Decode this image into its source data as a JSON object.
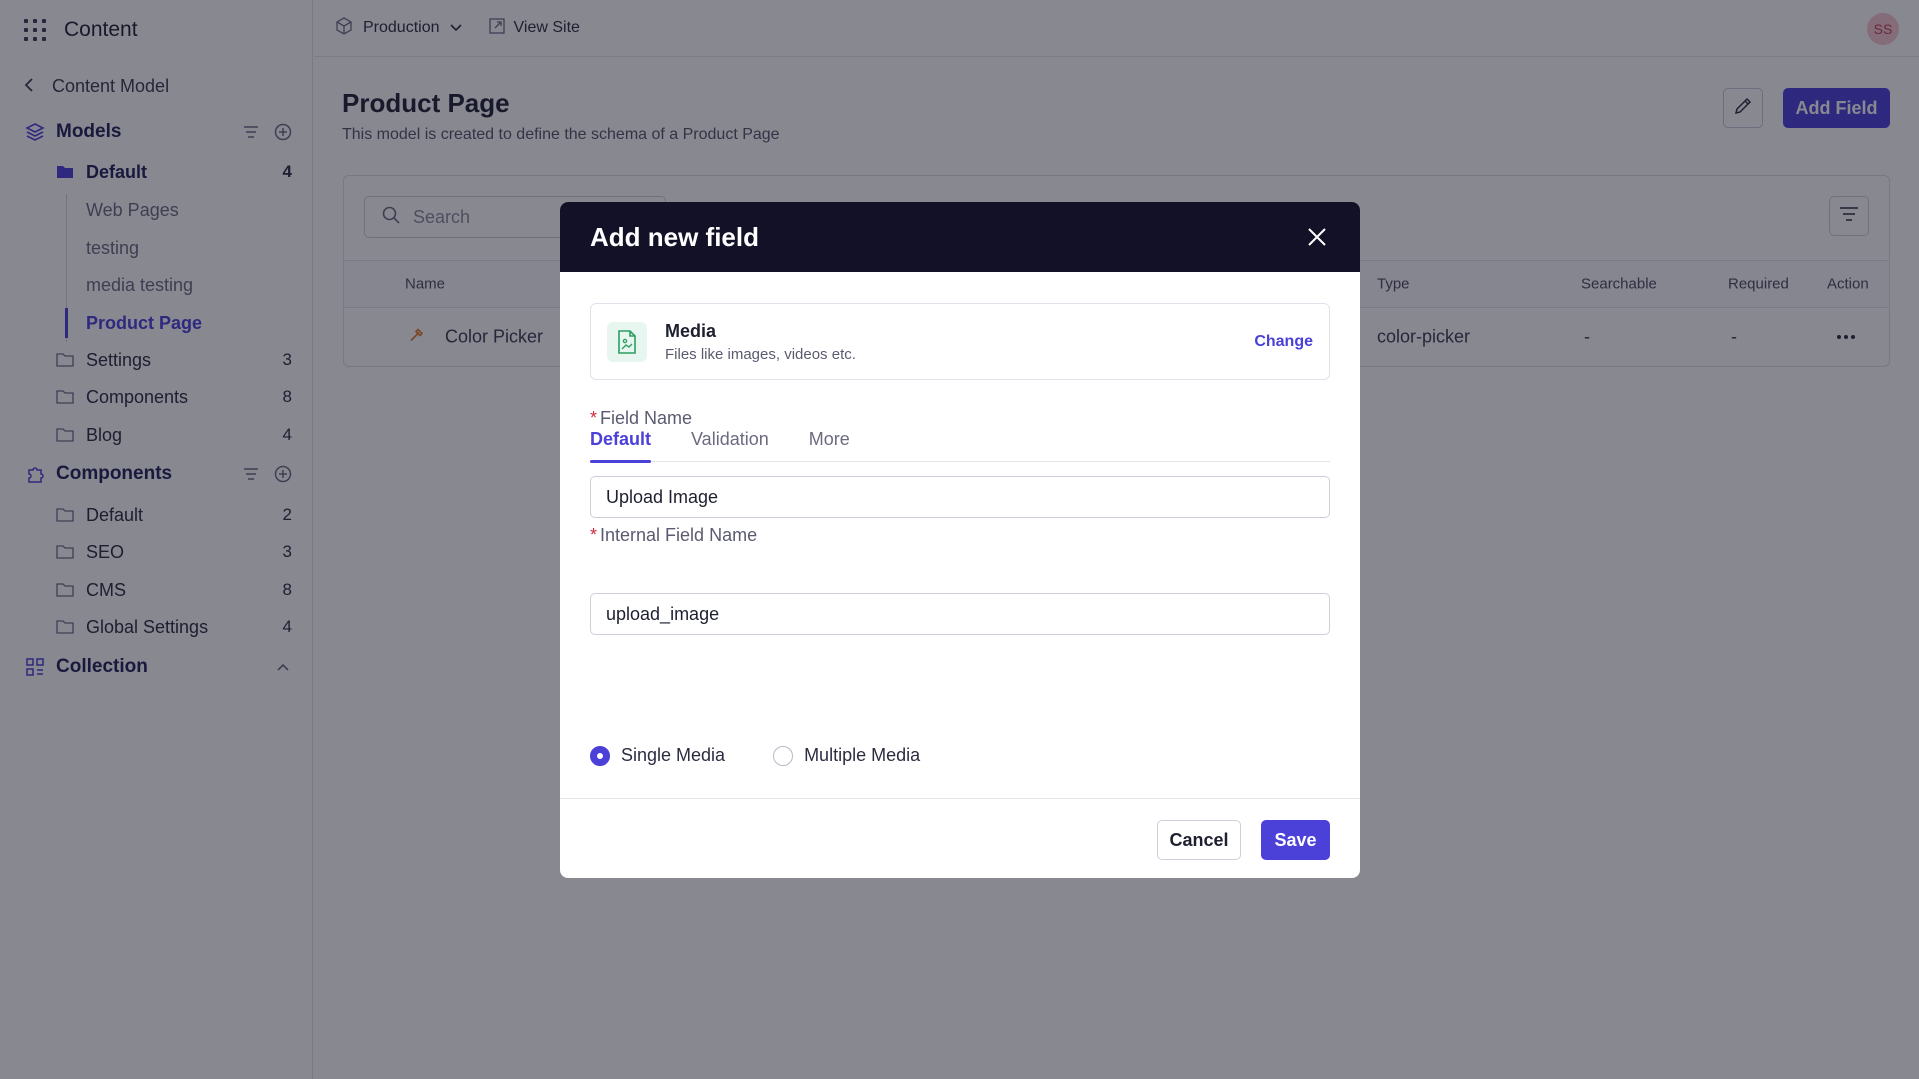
{
  "app": {
    "title": "Content"
  },
  "topbar": {
    "environment": "Production",
    "view_site": "View Site",
    "avatar_initials": "SS"
  },
  "sidebar": {
    "back_label": "Content Model",
    "models": {
      "label": "Models",
      "folders": [
        {
          "name": "Default",
          "count": "4",
          "items": [
            "Web Pages",
            "testing",
            "media testing",
            "Product Page"
          ]
        },
        {
          "name": "Settings",
          "count": "3"
        },
        {
          "name": "Components",
          "count": "8"
        },
        {
          "name": "Blog",
          "count": "4"
        }
      ]
    },
    "components": {
      "label": "Components",
      "folders": [
        {
          "name": "Default",
          "count": "2"
        },
        {
          "name": "SEO",
          "count": "3"
        },
        {
          "name": "CMS",
          "count": "8"
        },
        {
          "name": "Global Settings",
          "count": "4"
        }
      ]
    },
    "collection": {
      "label": "Collection"
    }
  },
  "page": {
    "title": "Product Page",
    "description": "This model is created to define the schema of a Product Page",
    "add_field_label": "Add Field"
  },
  "table": {
    "search_placeholder": "Search",
    "columns": {
      "name": "Name",
      "type": "Type",
      "searchable": "Searchable",
      "required": "Required",
      "action": "Action"
    },
    "rows": [
      {
        "name": "Color Picker",
        "type": "color-picker",
        "searchable": "-",
        "required": "-"
      }
    ]
  },
  "modal": {
    "title": "Add new field",
    "field_type": {
      "name": "Media",
      "description": "Files like images, videos etc.",
      "change_label": "Change"
    },
    "tabs": [
      "Default",
      "Validation",
      "More"
    ],
    "active_tab": "Default",
    "field_name": {
      "label": "Field Name",
      "value": "Upload Image"
    },
    "internal_field_name": {
      "label": "Internal Field Name",
      "value": "upload_image"
    },
    "media_options": [
      {
        "label": "Single Media",
        "checked": true
      },
      {
        "label": "Multiple Media",
        "checked": false
      }
    ],
    "cancel_label": "Cancel",
    "save_label": "Save"
  },
  "colors": {
    "accent": "#4b40d8",
    "modal_header": "#121128",
    "required": "#d4293d",
    "media_icon": "#2e9e63"
  },
  "icons": {
    "app_menu": "grid-icon",
    "environment": "cube-icon",
    "view_site": "external-link-icon",
    "back": "chevron-left-icon",
    "models": "layers-icon",
    "components": "puzzle-icon",
    "collection": "collection-icon",
    "folder": "folder-icon",
    "search": "search-icon",
    "filter": "filter-lines-icon",
    "edit": "pencil-icon",
    "close": "close-icon",
    "media": "image-file-icon"
  }
}
